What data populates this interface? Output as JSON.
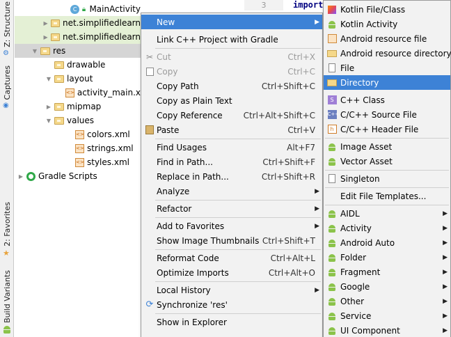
{
  "side_tabs": {
    "structure": "Z: Structure",
    "captures": "Captures",
    "favorites": "2: Favorites",
    "build_variants": "Build Variants"
  },
  "tree": {
    "main_activity": "MainActivity",
    "pkg_test1": "net.simplifiedlearn",
    "pkg_test2": "net.simplifiedlearn",
    "res": "res",
    "drawable": "drawable",
    "layout": "layout",
    "activity_main": "activity_main.x",
    "mipmap": "mipmap",
    "values": "values",
    "colors": "colors.xml",
    "strings": "strings.xml",
    "styles": "styles.xml",
    "gradle_scripts": "Gradle Scripts"
  },
  "editor": {
    "line_number": "3",
    "code": "import"
  },
  "context_menu": {
    "new": "New",
    "link_cpp": "Link C++ Project with Gradle",
    "cut": "Cut",
    "cut_sc": "Ctrl+X",
    "copy": "Copy",
    "copy_sc": "Ctrl+C",
    "copy_path": "Copy Path",
    "copy_path_sc": "Ctrl+Shift+C",
    "copy_plain": "Copy as Plain Text",
    "copy_ref": "Copy Reference",
    "copy_ref_sc": "Ctrl+Alt+Shift+C",
    "paste": "Paste",
    "paste_sc": "Ctrl+V",
    "find_usages": "Find Usages",
    "find_usages_sc": "Alt+F7",
    "find_in_path": "Find in Path...",
    "find_in_path_sc": "Ctrl+Shift+F",
    "replace_in_path": "Replace in Path...",
    "replace_in_path_sc": "Ctrl+Shift+R",
    "analyze": "Analyze",
    "refactor": "Refactor",
    "add_favorites": "Add to Favorites",
    "show_thumbnails": "Show Image Thumbnails",
    "show_thumbnails_sc": "Ctrl+Shift+T",
    "reformat": "Reformat Code",
    "reformat_sc": "Ctrl+Alt+L",
    "optimize": "Optimize Imports",
    "optimize_sc": "Ctrl+Alt+O",
    "local_history": "Local History",
    "synchronize": "Synchronize 'res'",
    "show_explorer": "Show in Explorer"
  },
  "submenu": {
    "kotlin_file": "Kotlin File/Class",
    "kotlin_activity": "Kotlin Activity",
    "android_res_file": "Android resource file",
    "android_res_dir": "Android resource directory",
    "file": "File",
    "directory": "Directory",
    "cpp_class": "C++ Class",
    "cpp_source": "C/C++ Source File",
    "cpp_header": "C/C++ Header File",
    "image_asset": "Image Asset",
    "vector_asset": "Vector Asset",
    "singleton": "Singleton",
    "edit_templates": "Edit File Templates...",
    "aidl": "AIDL",
    "activity": "Activity",
    "android_auto": "Android Auto",
    "folder": "Folder",
    "fragment": "Fragment",
    "google": "Google",
    "other": "Other",
    "service": "Service",
    "ui_component": "UI Component"
  },
  "colors": {
    "highlight": "#3d82d6",
    "menu_bg": "#f2f2f2",
    "tree_hl": "#e4f0d5"
  }
}
